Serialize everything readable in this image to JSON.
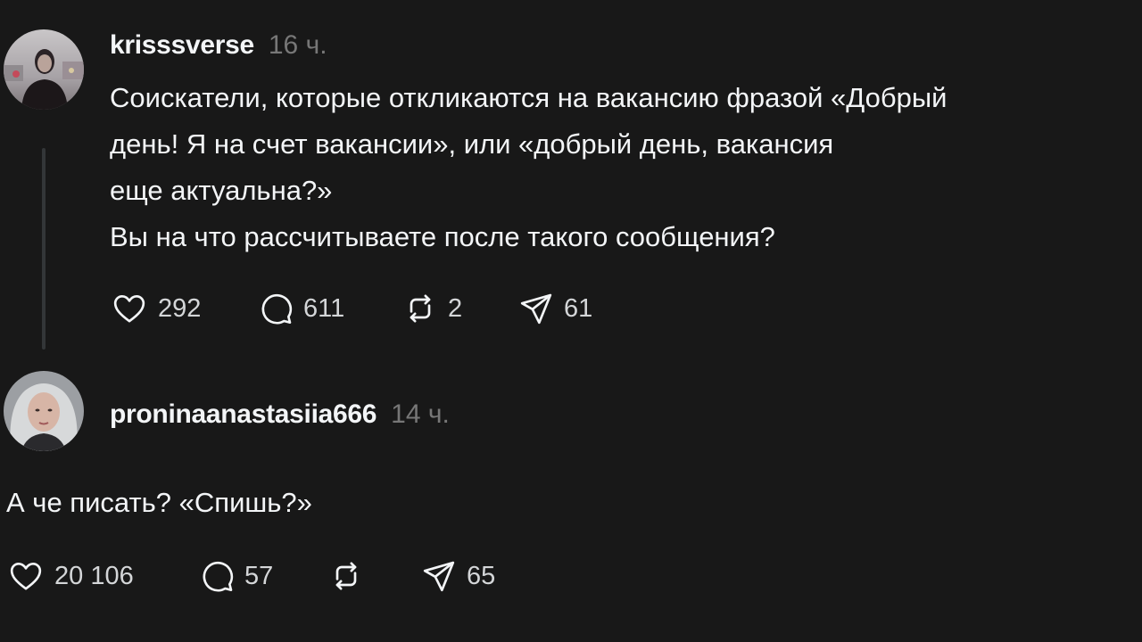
{
  "posts": [
    {
      "username": "krisssverse",
      "time": "16 ч.",
      "avatar_icon": "profile-photo",
      "text_lines": [
        "Соискатели, которые откликаются на вакансию фразой «Добрый",
        "день! Я на счет вакансии», или «добрый день, вакансия",
        "еще актуальна?»",
        "Вы на что рассчитываете после такого сообщения?"
      ],
      "likes": "292",
      "comments": "611",
      "reposts": "2",
      "shares": "61"
    },
    {
      "username": "proninaanastasiia666",
      "time": "14 ч.",
      "avatar_icon": "profile-photo",
      "text_lines": [
        "А че писать? «Спишь?»"
      ],
      "likes": "20 106",
      "comments": "57",
      "reposts": "",
      "shares": "65"
    }
  ],
  "icons": {
    "like": "heart-icon",
    "comment": "comment-bubble-icon",
    "repost": "repost-icon",
    "share": "send-icon"
  },
  "colors": {
    "background": "#181818",
    "text": "#f3f5f7",
    "muted": "#777777",
    "thread_line": "#333638"
  }
}
